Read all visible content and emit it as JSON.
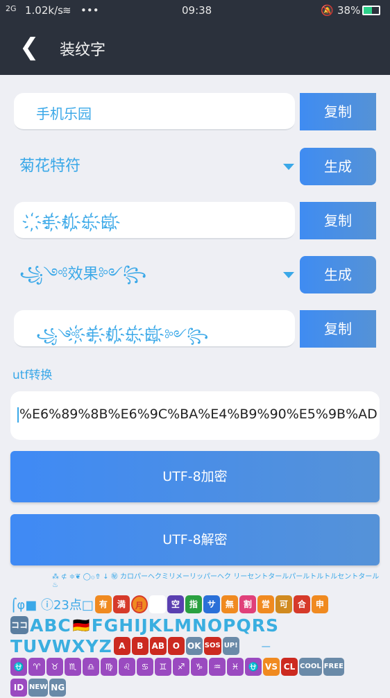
{
  "status": {
    "network": "2G",
    "speed": "1.02k/s",
    "more": "•••",
    "time": "09:38",
    "battery": "38%"
  },
  "header": {
    "title": "装纹字"
  },
  "input": {
    "value": "手机乐园",
    "copy_label": "复制"
  },
  "style1": {
    "selected": "菊花特符",
    "generate_label": "生成"
  },
  "output1": {
    "value": "҉手҉机҉乐҉园҉",
    "copy_label": "复制"
  },
  "style2": {
    "selected": "꧁༺效果༻꧂",
    "generate_label": "生成"
  },
  "output2": {
    "value": "꧁༺҉手҉机҉乐҉园҉༻꧂",
    "copy_label": "复制"
  },
  "utf": {
    "label": "utf转换",
    "value": "%E6%89%8B%E6%9C%BA%E4%B9%90%E5%9B%AD",
    "encode_label": "UTF-8加密",
    "decode_label": "UTF-8解密"
  },
  "emoji": {
    "row0": "⁂ ⊄      ≑❦ ◯۞⇮   ↓ ㊙ カロパーヘクミリメーリッパーヘク リーセントタールパールトルトルセントタール ♨",
    "row1_text": "⌠φ■ ⓘ23点□",
    "row1_tags": [
      "有",
      "満",
      "月",
      "得",
      "空",
      "指",
      "サ",
      "無",
      "割",
      "営",
      "可",
      "合",
      "申"
    ],
    "row2_tag": "ココ",
    "row2_letters": "ABC",
    "row2_flag": "🇩🇪",
    "row2_letters2": "FGHIJKLMNOPQRS",
    "row3_letters": "TUVWXYZ",
    "row3_tags": [
      "A",
      "B",
      "AB",
      "O",
      "OK",
      "SOS",
      "UP!"
    ],
    "row3_dash": "一",
    "row4_tags": [
      "⛎",
      "♈",
      "♉",
      "♏",
      "♎",
      "♍",
      "♌",
      "♋",
      "♊",
      "♐",
      "♑",
      "♒",
      "♓",
      "⛎",
      "VS",
      "CL",
      "COOL",
      "FREE"
    ],
    "row5_tags": [
      "ID",
      "NEW",
      "NG"
    ]
  }
}
